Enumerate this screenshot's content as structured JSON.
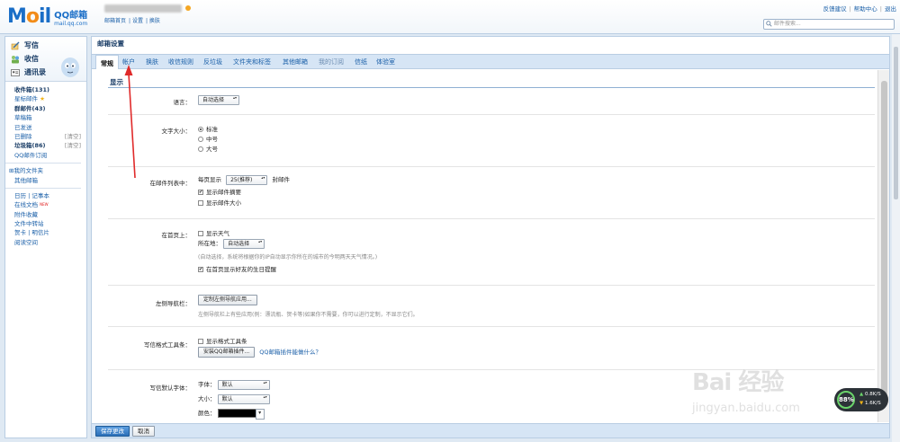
{
  "logo": {
    "mark": "Mail",
    "name": "QQ邮箱",
    "domain": "mail.qq.com"
  },
  "header": {
    "user_links": [
      "邮箱首页",
      "设置",
      "换肤"
    ],
    "top_links": [
      "反馈建议",
      "帮助中心",
      "退出"
    ],
    "search_placeholder": "邮件搜索..."
  },
  "sidebar": {
    "quick": [
      "写信",
      "收信",
      "通讯录"
    ],
    "folders": [
      {
        "label": "收件箱(131)",
        "bold": true
      },
      {
        "label": "星标邮件",
        "star": "★"
      },
      {
        "label": "群邮件(43)",
        "bold": true
      },
      {
        "label": "草稿箱"
      },
      {
        "label": "已发送"
      },
      {
        "label": "已删除",
        "clear": "[清空]"
      },
      {
        "label": "垃圾箱(86)",
        "bold": true,
        "clear": "[清空]"
      },
      {
        "label": "QQ邮件订阅"
      }
    ],
    "my_folders": "⊞我的文件夹",
    "other_mail": "其他邮箱",
    "tools": [
      {
        "label": "日历 | 记事本"
      },
      {
        "label": "在线文档",
        "new": "NEW"
      },
      {
        "label": "附件收藏"
      },
      {
        "label": "文件中转站"
      },
      {
        "label": "贺卡 | 明信片"
      },
      {
        "label": "阅读空间"
      }
    ]
  },
  "main": {
    "title": "邮箱设置",
    "tabs": [
      "常规",
      "帐户",
      "换肤",
      "收信规则",
      "反垃圾",
      "文件夹和标签",
      "其他邮箱",
      "我的订阅",
      "信纸",
      "体验室"
    ],
    "section": "显示",
    "language": {
      "label": "语言：",
      "value": "自动选择"
    },
    "font_size": {
      "label": "文字大小：",
      "options": [
        "标准",
        "中号",
        "大号"
      ],
      "selected": 0
    },
    "list": {
      "label": "在邮件列表中：",
      "per_page_prefix": "每页显示",
      "per_page_value": "25(推荐)",
      "per_page_suffix": "封邮件",
      "show_summary": "显示邮件摘要",
      "show_size": "显示邮件大小"
    },
    "home": {
      "label": "在首页上：",
      "show_weather": "显示天气",
      "location_label": "所在地：",
      "location_value": "自动选择",
      "note": "(自动选择，系统将根据你的IP自动显示你所在的城市的今明两天天气情况。)",
      "birthday": "在首页显示好友的生日提醒"
    },
    "leftnav": {
      "label": "左侧导航栏：",
      "button": "定制左侧导航应用...",
      "note": "左侧导航栏上有些应用(例：漂流瓶、贺卡等)如果你不需要，你可以进行定制，不显示它们。"
    },
    "toolbar": {
      "label": "写信格式工具条：",
      "check": "显示格式工具条",
      "button": "安装QQ邮箱插件...",
      "link": "QQ邮箱插件能做什么？"
    },
    "font": {
      "label": "写信默认字体：",
      "family_label": "字体：",
      "family_value": "默认",
      "size_label": "大小：",
      "size_value": "默认",
      "color_label": "颜色："
    },
    "save_button": "保存更改",
    "cancel_button": "取消"
  },
  "watermark": {
    "brand": "Bai 经验",
    "url": "jingyan.baidu.com"
  },
  "speed_widget": {
    "percent": "88%",
    "up": "0.8K/S",
    "down": "1.6K/S"
  },
  "colors": {
    "accent": "#1a5fa8",
    "tab_bar": "#d6e5f5",
    "arrow": "#e02a2a"
  }
}
